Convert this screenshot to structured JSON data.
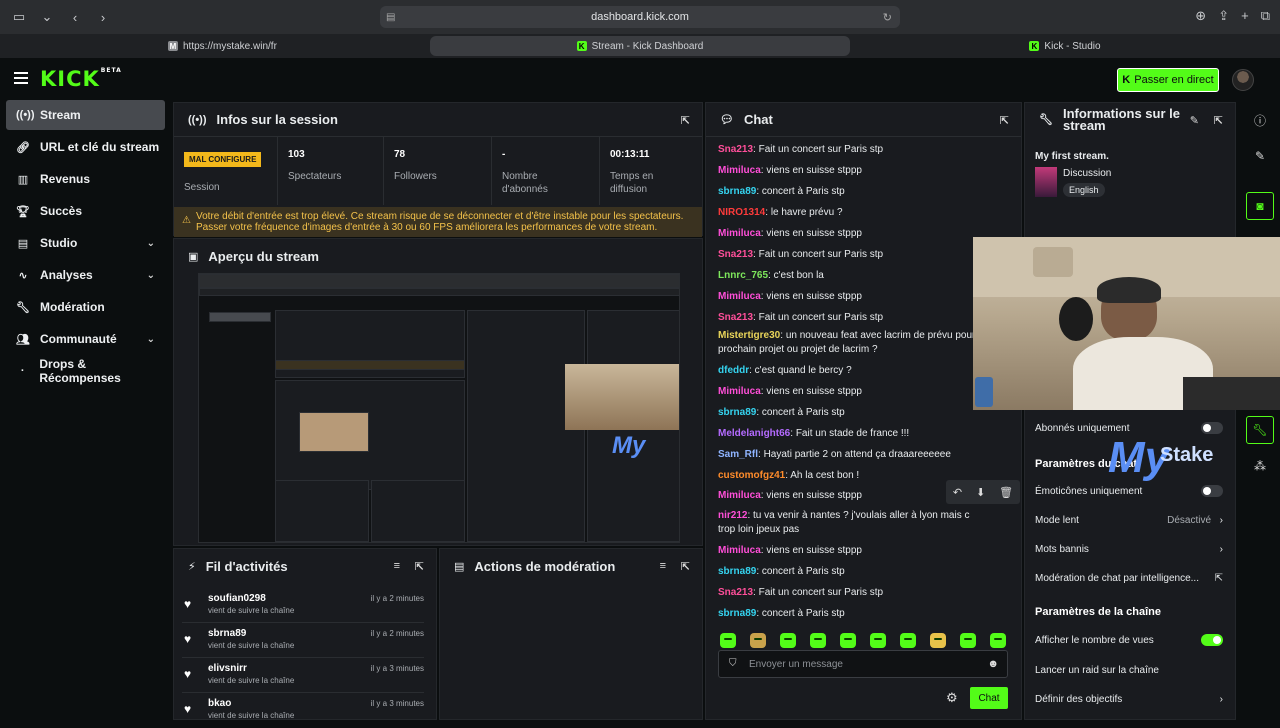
{
  "browser": {
    "url": "dashboard.kick.com",
    "tabs": [
      {
        "label": "https://mystake.win/fr",
        "active": false
      },
      {
        "label": "Stream - Kick Dashboard",
        "active": true
      },
      {
        "label": "Kick - Studio",
        "active": false
      }
    ]
  },
  "app": {
    "logo": "KICK",
    "logo_sup": "BETA",
    "go_live": "Passer en direct",
    "accent": "#53fc18"
  },
  "sidebar": {
    "items": [
      {
        "label": "Stream",
        "icon": "broadcast-icon",
        "active": true,
        "chevron": false
      },
      {
        "label": "URL et clé du stream",
        "icon": "link-icon",
        "active": false,
        "chevron": false
      },
      {
        "label": "Revenus",
        "icon": "chart-icon",
        "active": false,
        "chevron": false
      },
      {
        "label": "Succès",
        "icon": "trophy-icon",
        "active": false,
        "chevron": false
      },
      {
        "label": "Studio",
        "icon": "studio-icon",
        "active": false,
        "chevron": true
      },
      {
        "label": "Analyses",
        "icon": "analytics-icon",
        "active": false,
        "chevron": true
      },
      {
        "label": "Modération",
        "icon": "wrench-icon",
        "active": false,
        "chevron": false
      },
      {
        "label": "Communauté",
        "icon": "community-icon",
        "active": false,
        "chevron": true
      },
      {
        "label": "Drops & Récompenses",
        "icon": "dot-icon",
        "active": false,
        "chevron": false
      }
    ]
  },
  "session": {
    "title": "Infos sur la session",
    "status_badge": "MAL CONFIGURE",
    "status_label": "Session",
    "stats": [
      {
        "value": "103",
        "label": "Spectateurs"
      },
      {
        "value": "78",
        "label": "Followers"
      },
      {
        "value": "-",
        "label": "Nombre d'abonnés"
      },
      {
        "value": "00:13:11",
        "label": "Temps en diffusion"
      }
    ],
    "warning_line1": "Votre débit d'entrée est trop élevé. Ce stream risque de se déconnecter et d'être instable pour les spectateurs.",
    "warning_line2": "Passer votre fréquence d'images d'entrée à 30 ou 60 FPS améliorera les performances de votre stream."
  },
  "preview": {
    "title": "Aperçu du stream"
  },
  "activity": {
    "title": "Fil d'activités",
    "items": [
      {
        "name": "soufian0298",
        "action": "vient de suivre la chaîne",
        "time": "il y a 2 minutes"
      },
      {
        "name": "sbrna89",
        "action": "vient de suivre la chaîne",
        "time": "il y a 2 minutes"
      },
      {
        "name": "elivsnirr",
        "action": "vient de suivre la chaîne",
        "time": "il y a 3 minutes"
      },
      {
        "name": "bkao",
        "action": "vient de suivre la chaîne",
        "time": "il y a 3 minutes"
      }
    ]
  },
  "moderation": {
    "title": "Actions de modération"
  },
  "chat": {
    "title": "Chat",
    "messages": [
      {
        "user": "Sna213",
        "color": "#ff4f9a",
        "text": "Fait un concert sur Paris stp"
      },
      {
        "user": "Mimiluca",
        "color": "#ff4fd8",
        "text": "viens en suisse stppp"
      },
      {
        "user": "sbrna89",
        "color": "#35d4f0",
        "text": "concert à Paris stp"
      },
      {
        "user": "NIRO1314",
        "color": "#ff3b3b",
        "text": "le havre prévu ?"
      },
      {
        "user": "Mimiluca",
        "color": "#ff4fd8",
        "text": "viens en suisse stppp"
      },
      {
        "user": "Sna213",
        "color": "#ff4f9a",
        "text": "Fait un concert sur Paris stp"
      },
      {
        "user": "Lnnrc_765",
        "color": "#7ee85c",
        "text": "c'est bon la"
      },
      {
        "user": "Mimiluca",
        "color": "#ff4fd8",
        "text": "viens en suisse stppp"
      },
      {
        "user": "Sna213",
        "color": "#ff4f9a",
        "text": "Fait un concert sur Paris stp"
      },
      {
        "user": "Mistertigre30",
        "color": "#e9d55a",
        "text": "un nouveau feat avec lacrim de prévu pour prochain projet ou projet de lacrim ?"
      },
      {
        "user": "dfeddr",
        "color": "#35d4f0",
        "text": "c'est quand le bercy ?"
      },
      {
        "user": "Mimiluca",
        "color": "#ff4fd8",
        "text": "viens en suisse stppp"
      },
      {
        "user": "sbrna89",
        "color": "#35d4f0",
        "text": "concert à Paris stp"
      },
      {
        "user": "Meldelanight66",
        "color": "#b46bff",
        "text": "Fait un stade de france !!!"
      },
      {
        "user": "Sam_Rfl",
        "color": "#8fb4ff",
        "text": "Hayati partie 2 on attend ça draaareeeeee"
      },
      {
        "user": "customofgz41",
        "color": "#ff8c2b",
        "text": "Ah la cest bon !"
      },
      {
        "user": "Mimiluca",
        "color": "#ff4fd8",
        "text": "viens en suisse stppp"
      },
      {
        "user": "nir212",
        "color": "#ff4fd8",
        "text": "tu va venir à nantes ? j'voulais aller à lyon mais c trop loin jpeux pas"
      },
      {
        "user": "Mimiluca",
        "color": "#ff4fd8",
        "text": "viens en suisse stppp"
      },
      {
        "user": "sbrna89",
        "color": "#35d4f0",
        "text": "concert à Paris stp"
      },
      {
        "user": "Sna213",
        "color": "#ff4f9a",
        "text": "Fait un concert sur Paris stp"
      },
      {
        "user": "sbrna89",
        "color": "#35d4f0",
        "text": "concert à Paris stp"
      }
    ],
    "input_placeholder": "Envoyer un message",
    "send_label": "Chat"
  },
  "info": {
    "title_line1": "Informations sur le",
    "title_line2": "stream",
    "stream_title": "My first stream.",
    "category": "Discussion",
    "language": "English",
    "rows_top": [
      {
        "label": "Abonnés uniquement",
        "type": "toggle",
        "on": false
      }
    ],
    "section_chat": "Paramètres du chat",
    "rows_chat": [
      {
        "label": "Émoticônes uniquement",
        "type": "toggle",
        "on": false
      },
      {
        "label": "Mode lent",
        "type": "value",
        "value": "Désactivé"
      },
      {
        "label": "Mots bannis",
        "type": "chevron"
      },
      {
        "label": "Modération de chat par intelligence...",
        "type": "external"
      }
    ],
    "section_channel": "Paramètres de la chaîne",
    "rows_channel": [
      {
        "label": "Afficher le nombre de vues",
        "type": "toggle",
        "on": true
      },
      {
        "label": "Lancer un raid sur la chaîne",
        "type": "none"
      },
      {
        "label": "Définir des objectifs",
        "type": "chevron"
      }
    ]
  },
  "overlay": {
    "brand_main": "My",
    "brand_sub": "Stake"
  }
}
